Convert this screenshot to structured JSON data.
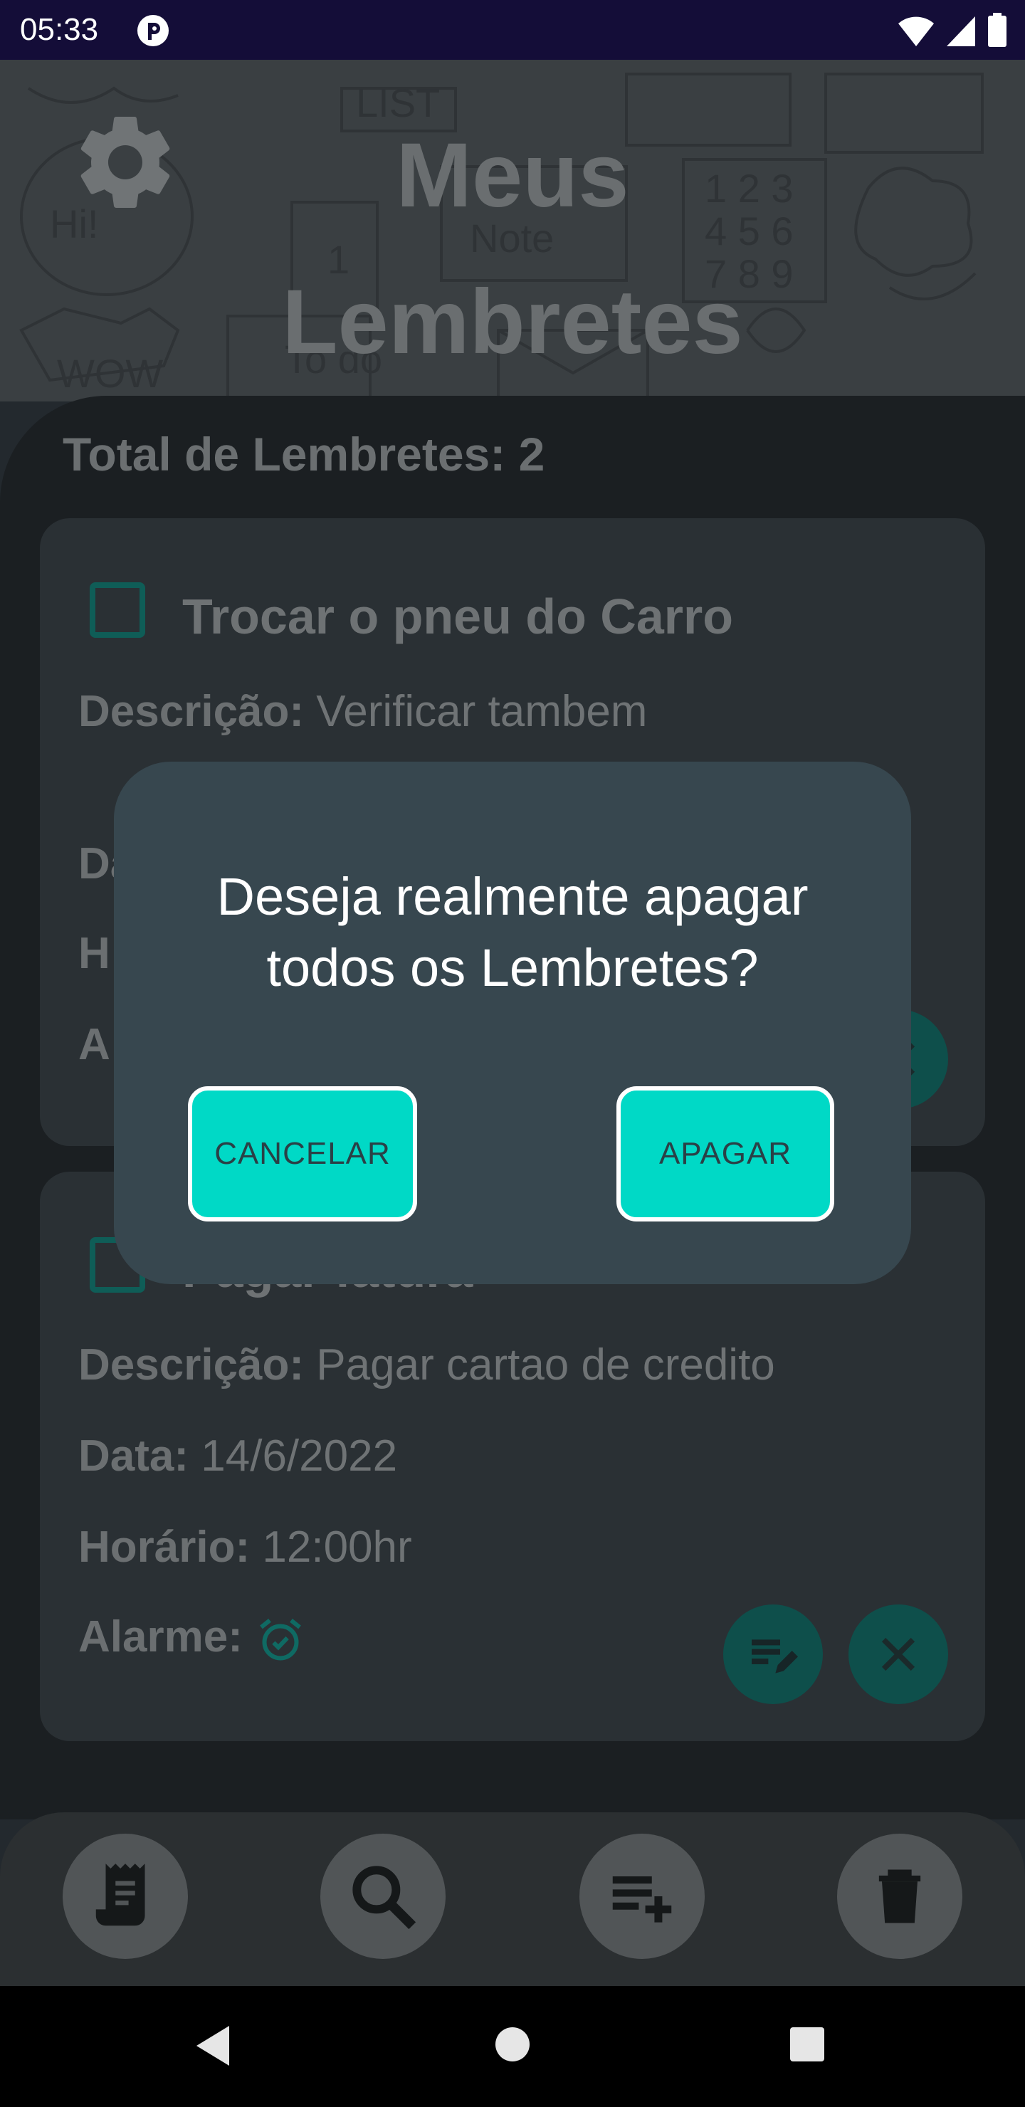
{
  "status_bar": {
    "time": "05:33"
  },
  "header": {
    "title_line1": "Meus",
    "title_line2": "Lembretes"
  },
  "summary": {
    "total_text": "Total de Lembretes: 2"
  },
  "reminders": [
    {
      "title": "Trocar o pneu do Carro",
      "description_label": "Descrição:",
      "description_value": "Verificar tambem",
      "date_label": "Da",
      "time_label": "H",
      "alarm_label": "A",
      "checked": false
    },
    {
      "title": "Pagar fatura",
      "description_label": "Descrição:",
      "description_value": "Pagar cartao de credito",
      "date_label": "Data:",
      "date_value": "14/6/2022",
      "time_label": "Horário:",
      "time_value": "12:00hr",
      "alarm_label": "Alarme:",
      "checked": false
    }
  ],
  "dialog": {
    "message_line1": "Deseja realmente apagar",
    "message_line2": "todos os Lembretes?",
    "cancel_label": "CANCELAR",
    "confirm_label": "APAGAR"
  },
  "bottom_actions": [
    {
      "icon": "receipt-icon"
    },
    {
      "icon": "search-icon"
    },
    {
      "icon": "playlist-add-icon"
    },
    {
      "icon": "trash-icon"
    }
  ],
  "colors": {
    "accent": "#00d9c6",
    "dialog_bg": "#37474f",
    "status_bar": "#140d38",
    "teal_dark": "#0e4f4b"
  }
}
